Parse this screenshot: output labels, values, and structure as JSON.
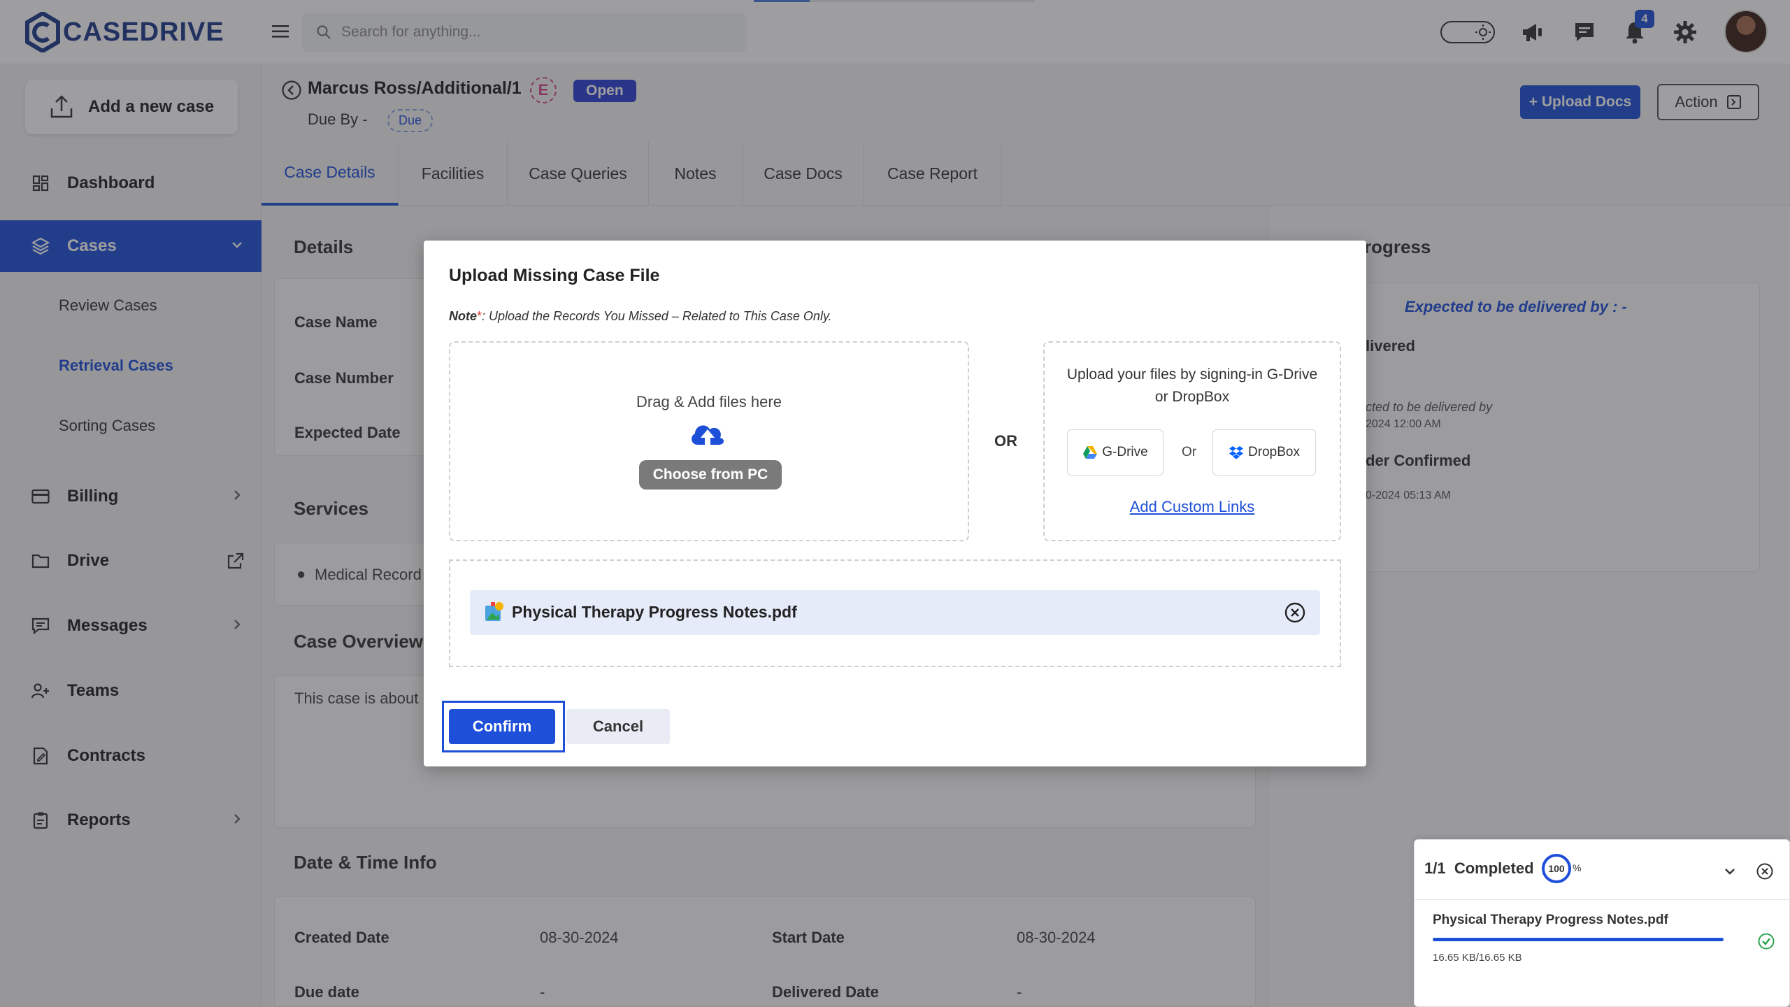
{
  "brand": {
    "logo_text": "CASEDRIVE"
  },
  "topbar": {
    "search_placeholder": "Search for anything...",
    "notification_count": "4"
  },
  "sidebar": {
    "add_case_label": "Add a new case",
    "items": [
      {
        "label": "Dashboard",
        "icon": "dashboard-icon"
      },
      {
        "label": "Cases",
        "icon": "layers-icon"
      },
      {
        "label": "Billing",
        "icon": "card-icon"
      },
      {
        "label": "Drive",
        "icon": "folder-icon"
      },
      {
        "label": "Messages",
        "icon": "message-icon"
      },
      {
        "label": "Teams",
        "icon": "users-icon"
      },
      {
        "label": "Contracts",
        "icon": "contract-icon"
      },
      {
        "label": "Reports",
        "icon": "clipboard-icon"
      }
    ],
    "sub_items": [
      "Review Cases",
      "Retrieval Cases",
      "Sorting Cases"
    ]
  },
  "case": {
    "title": "Marcus Ross/Additional/1",
    "e_badge": "E",
    "status": "Open",
    "due_by_label": "Due By -",
    "due_chip": "Due",
    "upload_docs_label": "+ Upload Docs",
    "action_label": "Action"
  },
  "tabs": [
    "Case Details",
    "Facilities",
    "Case Queries",
    "Notes",
    "Case Docs",
    "Case Report"
  ],
  "details": {
    "section_title": "Details",
    "labels": [
      "Case Name",
      "Case Number",
      "Expected Date"
    ],
    "services_title": "Services",
    "service_item": "Medical Record",
    "overview_title": "Case Overview",
    "overview_text": "This case is about",
    "datetime_title": "Date & Time Info",
    "created_label": "Created Date",
    "created_value": "08-30-2024",
    "start_label": "Start Date",
    "start_value": "08-30-2024",
    "due_label": "Due date",
    "due_value": "-",
    "delivered_label": "Delivered Date",
    "delivered_value": "-"
  },
  "progress_panel": {
    "title_fragment": "rogress",
    "expected": "Expected to be delivered by : -",
    "delivered_fragment": "livered",
    "expected_fragment": "cted to be delivered by",
    "expected_date_fragment": "2024 12:00 AM",
    "order_fragment": "der Confirmed",
    "order_date_fragment": "0-2024 05:13 AM"
  },
  "upload_widget": {
    "count": "1/1",
    "status": "Completed",
    "percent_value": "100",
    "percent_sign": "%",
    "file_name": "Physical Therapy Progress Notes.pdf",
    "size": "16.65 KB/16.65 KB",
    "progress": 1.0
  },
  "modal": {
    "title": "Upload Missing Case File",
    "note_label": "Note",
    "note_star": "*",
    "note_text": ": Upload the Records You Missed – Related to This Case Only.",
    "drag_text": "Drag & Add files here",
    "choose_label": "Choose from PC",
    "or_label": "OR",
    "cloud_text": "Upload your files by signing-in G-Drive or DropBox",
    "gdrive_label": "G-Drive",
    "or_small": "Or",
    "dropbox_label": "DropBox",
    "custom_links_label": "Add Custom Links",
    "file_name": "Physical Therapy Progress Notes.pdf",
    "confirm_label": "Confirm",
    "cancel_label": "Cancel"
  },
  "colors": {
    "accent": "#1e4fd8",
    "brand": "#1d3a8a"
  }
}
